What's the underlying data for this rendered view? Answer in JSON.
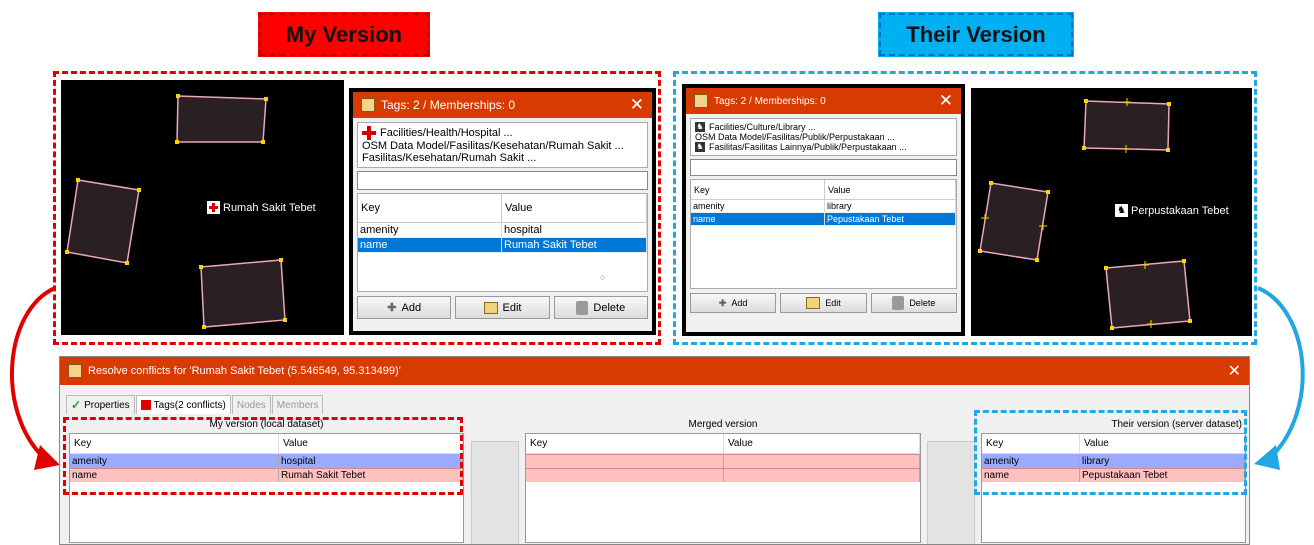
{
  "banners": {
    "mine": "My Version",
    "theirs": "Their Version"
  },
  "mine": {
    "map_label": "Rumah Sakit Tebet",
    "dialog": {
      "title": "Tags: 2 / Memberships: 0",
      "presets": [
        "Facilities/Health/Hospital ...",
        "OSM Data Model/Fasilitas/Kesehatan/Rumah Sakit ...",
        "Fasilitas/Kesehatan/Rumah Sakit ..."
      ],
      "col_key": "Key",
      "col_value": "Value",
      "rows": [
        {
          "key": "amenity",
          "value": "hospital"
        },
        {
          "key": "name",
          "value": "Rumah Sakit Tebet"
        }
      ],
      "add": "Add",
      "edit": "Edit",
      "delete": "Delete"
    }
  },
  "theirs": {
    "map_label": "Perpustakaan Tebet",
    "dialog": {
      "title": "Tags: 2 / Memberships: 0",
      "presets": [
        "Facilities/Culture/Library ...",
        "OSM Data Model/Fasilitas/Publik/Perpustakaan ...",
        "Fasilitas/Fasilitas Lainnya/Publik/Perpustakaan ..."
      ],
      "col_key": "Key",
      "col_value": "Value",
      "rows": [
        {
          "key": "amenity",
          "value": "library"
        },
        {
          "key": "name",
          "value": "Pepustakaan Tebet"
        }
      ],
      "add": "Add",
      "edit": "Edit",
      "delete": "Delete"
    }
  },
  "resolve": {
    "title": "Resolve conflicts for 'Rumah Sakit Tebet (5.546549, 95.313499)'",
    "tabs": {
      "properties": "Properties",
      "tags": "Tags(2 conflicts)",
      "nodes": "Nodes",
      "members": "Members"
    },
    "my_caption": "My version (local dataset)",
    "merged_caption": "Merged version",
    "their_caption": "Their version (server dataset)",
    "col_key": "Key",
    "col_value": "Value",
    "my_rows": [
      {
        "key": "amenity",
        "value": "hospital"
      },
      {
        "key": "name",
        "value": "Rumah Sakit Tebet"
      }
    ],
    "their_rows": [
      {
        "key": "amenity",
        "value": "library"
      },
      {
        "key": "name",
        "value": "Pepustakaan Tebet"
      }
    ]
  },
  "colors": {
    "mine_accent": "#e00000",
    "theirs_accent": "#22a7e0",
    "titlebar": "#d83b01",
    "row_blue": "#99aaff",
    "row_pink": "#ffc0c0",
    "selected": "#0078d7"
  },
  "icons": [
    "hospital-icon",
    "library-icon",
    "close-icon",
    "add-icon",
    "edit-icon",
    "delete-icon",
    "check-icon",
    "curved-arrow-icon"
  ]
}
